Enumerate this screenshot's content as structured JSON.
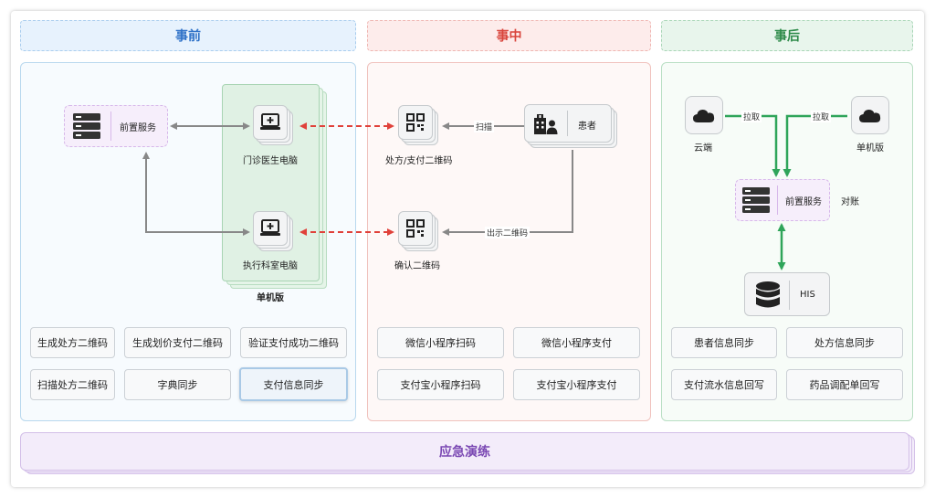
{
  "phases": {
    "before": "事前",
    "during": "事中",
    "after": "事后"
  },
  "before": {
    "front_service": "前置服务",
    "outpatient_pc": "门诊医生电脑",
    "exec_pc": "执行科室电脑",
    "standalone": "单机版",
    "chips": [
      "生成处方二维码",
      "生成划价支付二维码",
      "验证支付成功二维码",
      "扫描处方二维码",
      "字典同步",
      "支付信息同步"
    ]
  },
  "during": {
    "rx_qr": "处方/支付二维码",
    "confirm_qr": "确认二维码",
    "patient": "患者",
    "scan": "扫描",
    "show_qr": "出示二维码",
    "chips": [
      "微信小程序扫码",
      "微信小程序支付",
      "支付宝小程序扫码",
      "支付宝小程序支付"
    ]
  },
  "after": {
    "cloud": "云端",
    "standalone": "单机版",
    "pull_left": "拉取",
    "pull_right": "拉取",
    "front_service": "前置服务",
    "reconcile": "对账",
    "his": "HIS",
    "chips": [
      "患者信息同步",
      "处方信息同步",
      "支付流水信息回写",
      "药品调配单回写"
    ]
  },
  "emergency": "应急演练",
  "colors": {
    "blue": "#2f72c8",
    "red": "#d9453c",
    "green": "#2d8a49",
    "purple": "#7a48b3",
    "flow_gray": "#888888",
    "flow_red": "#e0413a",
    "flow_green": "#2fa55a"
  }
}
